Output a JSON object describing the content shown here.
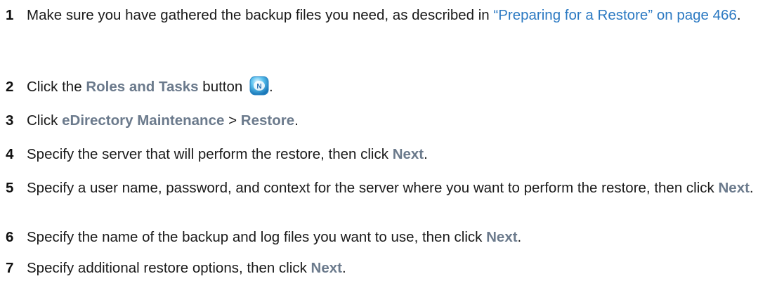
{
  "steps": [
    {
      "num": "1",
      "pre": "Make sure you have gathered the backup files you need, as described in ",
      "link": "“Preparing for a Restore” on page 466",
      "post": "."
    },
    {
      "num": "2",
      "pre": "Click the ",
      "ui1": "Roles and Tasks",
      "post": " button ",
      "icon": "roles-and-tasks-icon",
      "end": "."
    },
    {
      "num": "3",
      "pre": "Click ",
      "ui1": "eDirectory Maintenance",
      "sep": " > ",
      "ui2": "Restore",
      "end": "."
    },
    {
      "num": "4",
      "pre": "Specify the server that will perform the restore, then click ",
      "ui1": "Next",
      "end": "."
    },
    {
      "num": "5",
      "pre": "Specify a user name, password, and context for the server where you want to perform the restore, then click ",
      "ui1": "Next",
      "end": "."
    },
    {
      "num": "6",
      "pre": "Specify the name of the backup and log files you want to use, then click ",
      "ui1": "Next",
      "end": "."
    },
    {
      "num": "7",
      "pre": "Specify additional restore options, then click ",
      "ui1": "Next",
      "end": "."
    }
  ],
  "colors": {
    "ui_label": "#6b7a8c",
    "link": "#2b79c2",
    "text": "#1a1a1a"
  }
}
